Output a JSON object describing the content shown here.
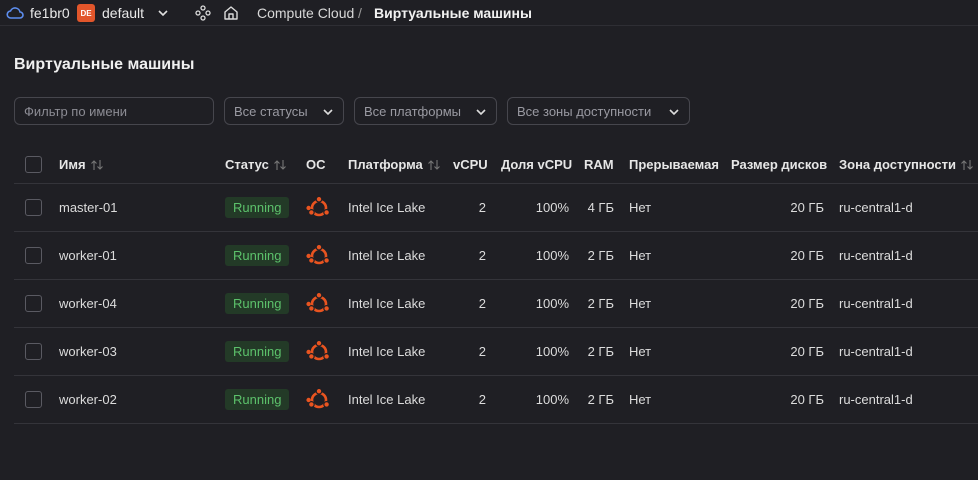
{
  "topbar": {
    "org": "fe1br0",
    "folder_badge": "DE",
    "folder": "default",
    "breadcrumb_service": "Compute Cloud",
    "breadcrumb_sep": "/",
    "breadcrumb_current": "Виртуальные машины"
  },
  "page": {
    "title": "Виртуальные машины"
  },
  "filters": {
    "name_placeholder": "Фильтр по имени",
    "statuses": "Все статусы",
    "platforms": "Все платформы",
    "zones": "Все зоны доступности"
  },
  "table": {
    "headers": {
      "name": "Имя",
      "status": "Статус",
      "os": "ОС",
      "platform": "Платформа",
      "vcpu": "vCPU",
      "vcpu_share": "Доля vCPU",
      "ram": "RAM",
      "preemptible": "Прерываемая",
      "disk_size": "Размер дисков",
      "zone": "Зона доступности"
    },
    "rows": [
      {
        "name": "master-01",
        "status": "Running",
        "os": "ubuntu-icon",
        "platform": "Intel Ice Lake",
        "vcpu": "2",
        "vcpu_share": "100%",
        "ram": "4 ГБ",
        "preemptible": "Нет",
        "disk_size": "20 ГБ",
        "zone": "ru-central1-d"
      },
      {
        "name": "worker-01",
        "status": "Running",
        "os": "ubuntu-icon",
        "platform": "Intel Ice Lake",
        "vcpu": "2",
        "vcpu_share": "100%",
        "ram": "2 ГБ",
        "preemptible": "Нет",
        "disk_size": "20 ГБ",
        "zone": "ru-central1-d"
      },
      {
        "name": "worker-04",
        "status": "Running",
        "os": "ubuntu-icon",
        "platform": "Intel Ice Lake",
        "vcpu": "2",
        "vcpu_share": "100%",
        "ram": "2 ГБ",
        "preemptible": "Нет",
        "disk_size": "20 ГБ",
        "zone": "ru-central1-d"
      },
      {
        "name": "worker-03",
        "status": "Running",
        "os": "ubuntu-icon",
        "platform": "Intel Ice Lake",
        "vcpu": "2",
        "vcpu_share": "100%",
        "ram": "2 ГБ",
        "preemptible": "Нет",
        "disk_size": "20 ГБ",
        "zone": "ru-central1-d"
      },
      {
        "name": "worker-02",
        "status": "Running",
        "os": "ubuntu-icon",
        "platform": "Intel Ice Lake",
        "vcpu": "2",
        "vcpu_share": "100%",
        "ram": "2 ГБ",
        "preemptible": "Нет",
        "disk_size": "20 ГБ",
        "zone": "ru-central1-d"
      }
    ]
  },
  "colors": {
    "background": "#1f1f24",
    "running_text": "#5cc16b",
    "running_bg": "#233a27",
    "ubuntu": "#e95420",
    "folder_badge": "#e2562b"
  }
}
